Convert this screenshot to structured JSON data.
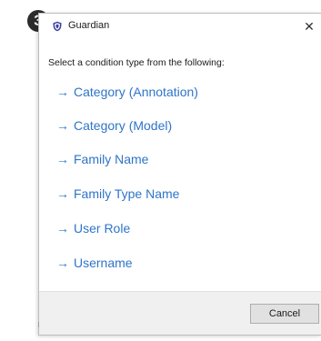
{
  "step": {
    "number": "3"
  },
  "window": {
    "title": "Guardian",
    "close_glyph": "✕"
  },
  "prompt": "Select a condition type from the following:",
  "options": [
    {
      "arrow": "→",
      "label": "Category (Annotation)"
    },
    {
      "arrow": "→",
      "label": "Category (Model)"
    },
    {
      "arrow": "→",
      "label": "Family Name"
    },
    {
      "arrow": "→",
      "label": "Family Type Name"
    },
    {
      "arrow": "→",
      "label": "User Role"
    },
    {
      "arrow": "→",
      "label": "Username"
    }
  ],
  "footer": {
    "cancel_label": "Cancel"
  },
  "colors": {
    "link": "#2e74c9",
    "footer_bg": "#f0f0f0",
    "badge_bg": "#2c2c2c"
  },
  "icons": {
    "app": "shield-icon",
    "close": "close-icon"
  }
}
